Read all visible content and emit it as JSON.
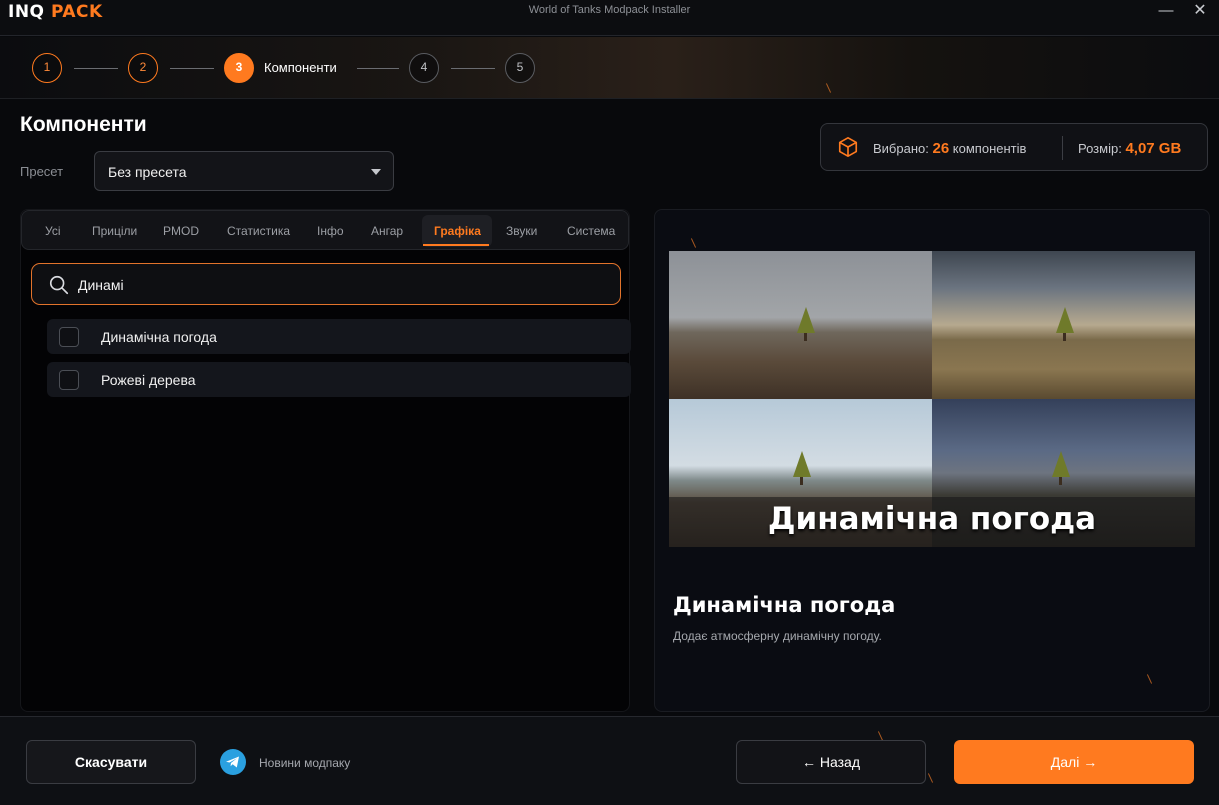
{
  "window": {
    "logo_part1": "INQ",
    "logo_part2": "PACK",
    "title": "World of Tanks Modpack Installer",
    "minimize": "—",
    "close": "✕"
  },
  "stepper": {
    "steps": [
      "1",
      "2",
      "3",
      "4",
      "5"
    ],
    "active_index": 2,
    "active_label": "Компоненти"
  },
  "header": {
    "title": "Компоненти",
    "preset_label": "Пресет",
    "preset_value": "Без пресета"
  },
  "summary": {
    "selected_label": "Вибрано:",
    "selected_count": "26",
    "selected_suffix": "компонентів",
    "size_label": "Розмір:",
    "size_value": "4,07 GB"
  },
  "tabs": [
    "Усі",
    "Приціли",
    "PMOD",
    "Статистика",
    "Інфо",
    "Ангар",
    "Графіка",
    "Звуки",
    "Система"
  ],
  "active_tab": "Графіка",
  "search": {
    "value": "Динамі"
  },
  "items": [
    {
      "label": "Динамічна погода",
      "checked": false
    },
    {
      "label": "Рожеві дерева",
      "checked": false
    }
  ],
  "preview": {
    "caption": "Динамічна погода",
    "title": "Динамічна погода",
    "description": "Додає атмосферну динамічну погоду."
  },
  "footer": {
    "cancel": "Скасувати",
    "news": "Новини модпаку",
    "back": "← Назад",
    "next": "Далі →"
  },
  "colors": {
    "accent": "#ff7a1f",
    "telegram": "#2aa0e0"
  }
}
